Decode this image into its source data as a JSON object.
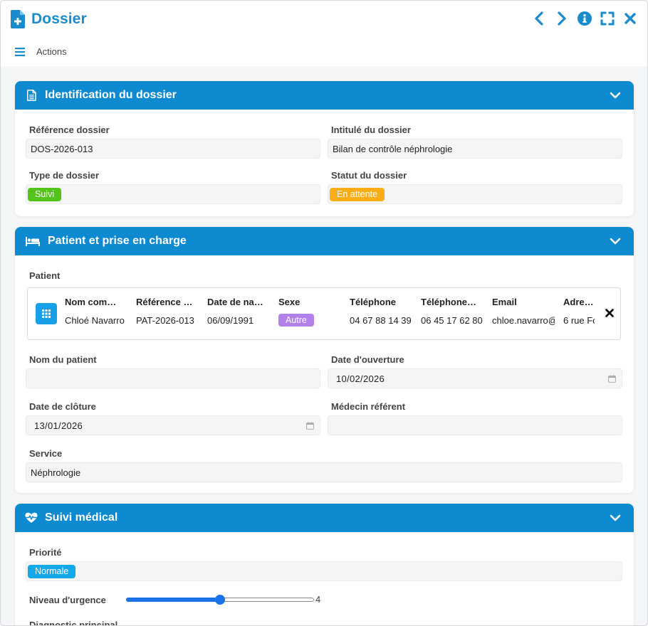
{
  "window": {
    "title": "Dossier",
    "actions_label": "Actions"
  },
  "sections": {
    "identification": {
      "title": "Identification du dossier",
      "reference_label": "Référence dossier",
      "reference_value": "DOS-2026-013",
      "intitule_label": "Intitulé du dossier",
      "intitule_value": "Bilan de contrôle néphrologie",
      "type_label": "Type de dossier",
      "type_value": "Suivi",
      "statut_label": "Statut du dossier",
      "statut_value": "En attente"
    },
    "patient": {
      "title": "Patient et prise en charge",
      "patient_label": "Patient",
      "table": {
        "headers": [
          "Nom com…",
          "Référence …",
          "Date de na…",
          "Sexe",
          "Téléphone",
          "Téléphone…",
          "Email",
          "Adress"
        ],
        "row": [
          "Chloé Navarro",
          "PAT-2026-013",
          "06/09/1991",
          "Autre",
          "04 67 88 14 39",
          "06 45 17 62 80",
          "chloe.navarro@",
          "6 rue Fo"
        ]
      },
      "nom_label": "Nom du patient",
      "nom_value": "",
      "ouverture_label": "Date d'ouverture",
      "ouverture_value": "10/02/2026",
      "cloture_label": "Date de clôture",
      "cloture_value": "13/01/2026",
      "medecin_label": "Médecin référent",
      "medecin_value": "",
      "service_label": "Service",
      "service_value": "Néphrologie"
    },
    "suivi": {
      "title": "Suivi médical",
      "priorite_label": "Priorité",
      "priorite_value": "Normale",
      "urgence_label": "Niveau d'urgence",
      "urgence_value": "4",
      "urgence_fraction": 0.5,
      "diagnostic_label": "Diagnostic principal"
    }
  },
  "colors": {
    "accent": "#0d8ad0",
    "title": "#1a8ccc",
    "badge_suivi": "#52c41a",
    "badge_attente": "#faad14",
    "badge_autre": "#b37feb",
    "badge_normale": "#13a8e8",
    "slider": "#1a73e8"
  },
  "icons": {
    "title": "file-plus-icon",
    "prev": "chevron-left-icon",
    "next": "chevron-right-icon",
    "info": "info-icon",
    "maximize": "expand-icon",
    "close": "close-icon",
    "menu": "hamburger-icon",
    "identification": "document-icon",
    "patient": "bed-icon",
    "suivi": "heart-pulse-icon",
    "collapse": "chevron-down-icon",
    "grid": "grid-icon",
    "remove": "x-icon",
    "calendar": "calendar-icon"
  }
}
